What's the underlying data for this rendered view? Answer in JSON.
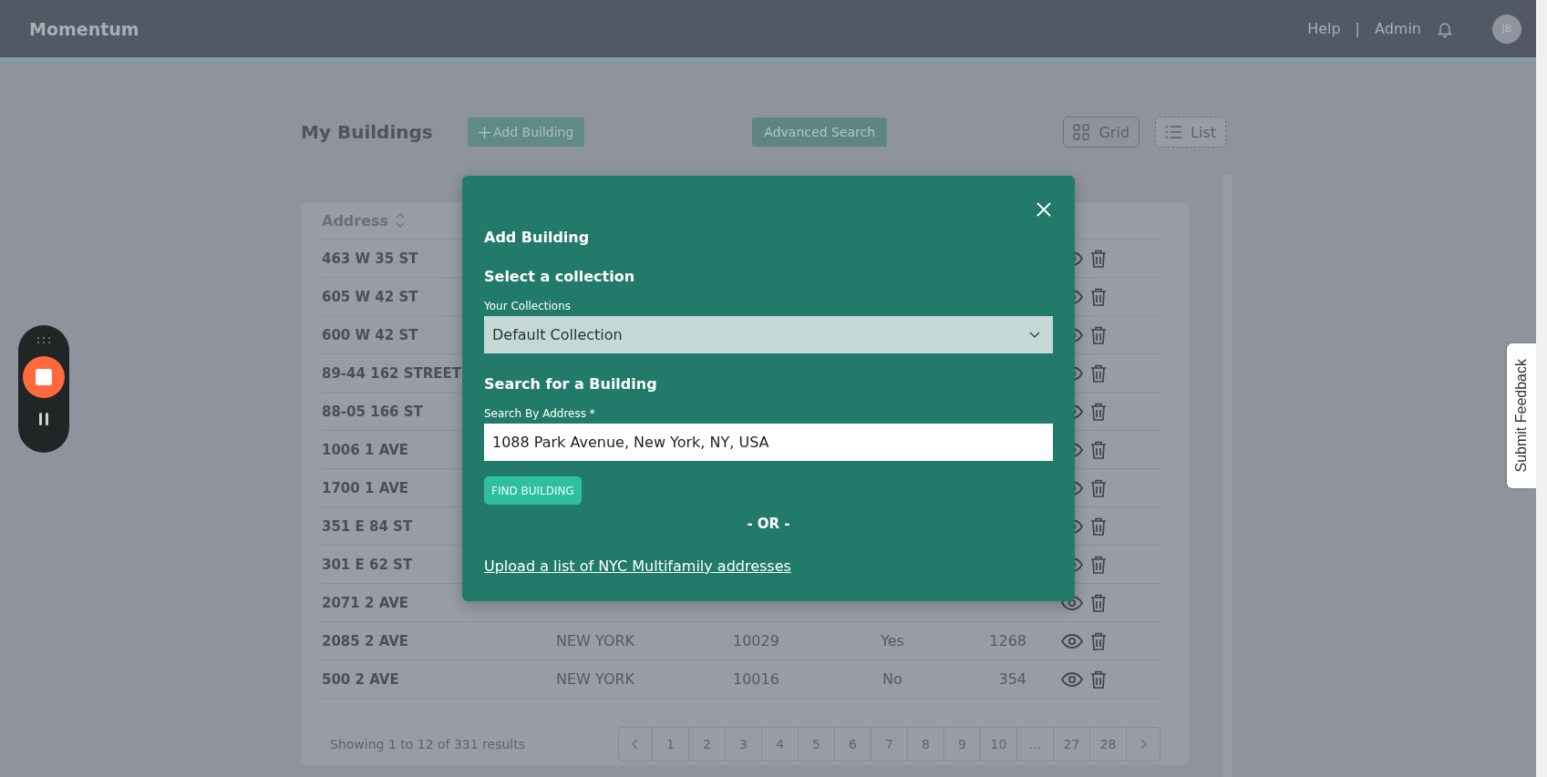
{
  "header": {
    "logo": "Momentum",
    "links": [
      "Help",
      "Admin"
    ],
    "separator": "|",
    "avatar": "JB"
  },
  "toolbar": {
    "title": "My Buildings",
    "add_button": "Add Building",
    "advanced_search": "Advanced Search",
    "views": [
      {
        "kind": "grid",
        "label": "Grid",
        "selected": false
      },
      {
        "kind": "list",
        "label": "List",
        "selected": true
      }
    ]
  },
  "table": {
    "columns": [
      "Address"
    ],
    "rows": [
      {
        "address": "463 W 35 ST"
      },
      {
        "address": "605 W 42 ST"
      },
      {
        "address": "600 W 42 ST"
      },
      {
        "address": "89-44 162 STREET"
      },
      {
        "address": "88-05 166 ST"
      },
      {
        "address": "1006 1 AVE"
      },
      {
        "address": "1700 1 AVE"
      },
      {
        "address": "351 E 84 ST"
      },
      {
        "address": "301 E 62 ST"
      },
      {
        "address": "2071 2 AVE"
      },
      {
        "address": "2085 2 AVE",
        "city": "NEW YORK",
        "zip": "10029",
        "column_4": "Yes",
        "column_5": "1268"
      },
      {
        "address": "500 2 AVE",
        "city": "NEW YORK",
        "zip": "10016",
        "column_4": "No",
        "column_5": "354"
      }
    ]
  },
  "pagination": {
    "summary": "Showing 1 to 12 of 331 results",
    "pages": [
      "1",
      "2",
      "3",
      "4",
      "5",
      "6",
      "7",
      "8",
      "9",
      "10",
      "...",
      "27",
      "28"
    ]
  },
  "modal": {
    "title": "Add Building",
    "collection_heading": "Select a collection",
    "collection_label": "Your Collections",
    "collection_value": "Default Collection",
    "search_heading": "Search for a Building",
    "search_label": "Search By Address *",
    "search_value": "1088 Park Avenue, New York, NY, USA",
    "find_button": "FIND BUILDING",
    "divider": "- OR -",
    "upload_link": "Upload a list of NYC Multifamily addresses"
  },
  "feedback_tab": "Submit Feedback"
}
